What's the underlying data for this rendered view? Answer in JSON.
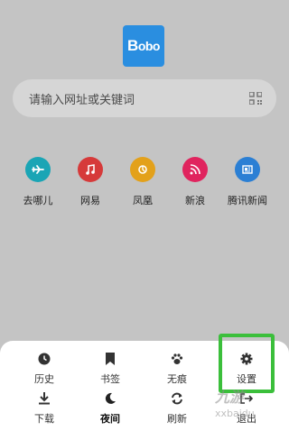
{
  "logo": {
    "first": "B",
    "rest": "obo"
  },
  "search": {
    "placeholder": "请输入网址或关键词",
    "icon": "qr-scan-icon"
  },
  "shortcuts": [
    {
      "label": "去哪儿",
      "icon": "plane-icon",
      "color": "#1aa5b5"
    },
    {
      "label": "网易",
      "icon": "music-icon",
      "color": "#d63a3a"
    },
    {
      "label": "凤凰",
      "icon": "phoenix-icon",
      "color": "#e3a11b"
    },
    {
      "label": "新浪",
      "icon": "rss-icon",
      "color": "#e0245e"
    },
    {
      "label": "腾讯新闻",
      "icon": "news-icon",
      "color": "#2b7fd4"
    }
  ],
  "menu": {
    "row1": [
      {
        "label": "历史",
        "icon": "clock-icon"
      },
      {
        "label": "书签",
        "icon": "bookmark-icon"
      },
      {
        "label": "无痕",
        "icon": "paw-icon"
      },
      {
        "label": "设置",
        "icon": "gear-icon"
      }
    ],
    "row2": [
      {
        "label": "下载",
        "icon": "download-icon"
      },
      {
        "label": "夜间",
        "icon": "moon-icon"
      },
      {
        "label": "刷新",
        "icon": "refresh-icon"
      },
      {
        "label": "退出",
        "icon": "exit-icon"
      }
    ]
  },
  "highlight_color": "#3bbf3b",
  "watermark": {
    "text": "九游",
    "subtext": "xxbaidu"
  }
}
